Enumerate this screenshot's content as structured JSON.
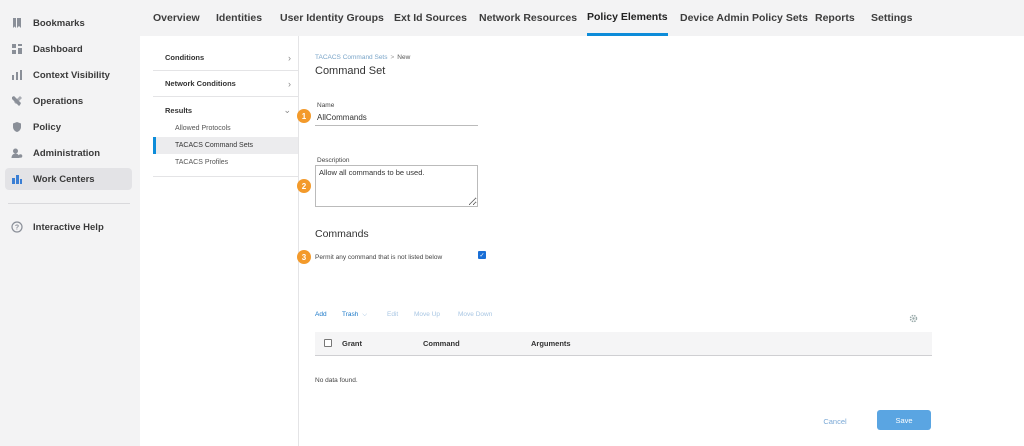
{
  "leftnav": {
    "items": [
      {
        "label": "Bookmarks",
        "icon": "bookmark-icon"
      },
      {
        "label": "Dashboard",
        "icon": "dashboard-icon"
      },
      {
        "label": "Context Visibility",
        "icon": "context-visibility-icon"
      },
      {
        "label": "Operations",
        "icon": "wrench-icon"
      },
      {
        "label": "Policy",
        "icon": "shield-icon"
      },
      {
        "label": "Administration",
        "icon": "admin-user-icon"
      },
      {
        "label": "Work Centers",
        "icon": "work-centers-icon",
        "active": true
      }
    ],
    "help": {
      "label": "Interactive Help",
      "icon": "help-icon"
    }
  },
  "tabs": [
    {
      "label": "Overview"
    },
    {
      "label": "Identities"
    },
    {
      "label": "User Identity Groups"
    },
    {
      "label": "Ext Id Sources"
    },
    {
      "label": "Network Resources"
    },
    {
      "label": "Policy Elements",
      "active": true
    },
    {
      "label": "Device Admin Policy Sets"
    },
    {
      "label": "Reports"
    },
    {
      "label": "Settings"
    }
  ],
  "sidebar2": {
    "sections": [
      {
        "label": "Conditions",
        "chevron": "›"
      },
      {
        "label": "Network Conditions",
        "chevron": "›"
      },
      {
        "label": "Results",
        "chevron": "⌄"
      }
    ],
    "items": [
      {
        "label": "Allowed Protocols"
      },
      {
        "label": "TACACS Command Sets",
        "active": true
      },
      {
        "label": "TACACS Profiles"
      }
    ]
  },
  "breadcrumb": {
    "parent": "TACACS Command Sets",
    "separator": ">",
    "current": "New"
  },
  "page_title": "Command Set",
  "form": {
    "name_label": "Name",
    "name_value": "AllCommands",
    "description_label": "Description",
    "description_value": "Allow all commands to be used.",
    "commands_heading": "Commands",
    "permit_label": "Permit any command that is not listed below",
    "permit_checked": true
  },
  "badges": [
    "1",
    "2",
    "3"
  ],
  "toolbar": {
    "add": "Add",
    "trash": "Trash",
    "trash_chevron": "⌵",
    "edit": "Edit",
    "move_up": "Move Up",
    "move_down": "Move Down"
  },
  "table": {
    "columns": [
      "Grant",
      "Command",
      "Arguments"
    ],
    "empty_text": "No data found."
  },
  "actions": {
    "cancel": "Cancel",
    "save": "Save"
  },
  "colors": {
    "accent": "#0d8cd9",
    "badge": "#f39a2b",
    "save": "#5aa5e2"
  }
}
